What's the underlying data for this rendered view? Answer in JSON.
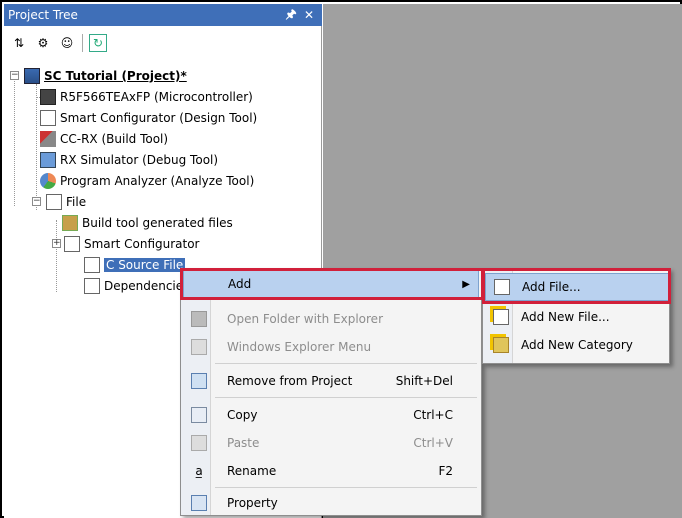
{
  "panel": {
    "title": "Project Tree",
    "pin_glyph": "⬍",
    "close_glyph": "✕",
    "toolbar_icons": [
      "sort-icon",
      "settings-icon",
      "user-icon",
      "refresh-icon"
    ]
  },
  "tree": {
    "project": "SC Tutorial (Project)*",
    "items": [
      {
        "label": "R5F566TEAxFP (Microcontroller)",
        "icon": "chip-icon"
      },
      {
        "label": "Smart Configurator (Design Tool)",
        "icon": "config-tool-icon"
      },
      {
        "label": "CC-RX (Build Tool)",
        "icon": "build-tool-icon"
      },
      {
        "label": "RX Simulator (Debug Tool)",
        "icon": "debug-tool-icon"
      },
      {
        "label": "Program Analyzer (Analyze Tool)",
        "icon": "analyzer-icon"
      },
      {
        "label": "File",
        "icon": "folder-icon"
      }
    ],
    "file_children": [
      {
        "label": "Build tool generated files",
        "icon": "generated-files-icon"
      },
      {
        "label": "Smart Configurator",
        "icon": "folder-icon"
      },
      {
        "label": "C Source File",
        "icon": "folder-icon"
      },
      {
        "label": "Dependencies",
        "icon": "folder-icon"
      }
    ]
  },
  "context_menu": {
    "items": [
      {
        "label": "Add",
        "shortcut": "",
        "disabled": false,
        "has_submenu": true
      },
      {
        "label": "Open Folder with Explorer",
        "shortcut": "",
        "disabled": true
      },
      {
        "label": "Windows Explorer Menu",
        "shortcut": "",
        "disabled": true
      },
      {
        "label": "Remove from Project",
        "shortcut": "Shift+Del",
        "disabled": false
      },
      {
        "label": "Copy",
        "shortcut": "Ctrl+C",
        "disabled": false
      },
      {
        "label": "Paste",
        "shortcut": "Ctrl+V",
        "disabled": true
      },
      {
        "label": "Rename",
        "shortcut": "F2",
        "disabled": false
      },
      {
        "label": "Property",
        "shortcut": "",
        "disabled": false
      }
    ]
  },
  "submenu": {
    "items": [
      {
        "label": "Add File..."
      },
      {
        "label": "Add New File..."
      },
      {
        "label": "Add New Category"
      }
    ]
  },
  "colors": {
    "title_bar": "#3f6fb8",
    "highlight": "#d1203a",
    "menu_hover": "#b9d1ef"
  }
}
